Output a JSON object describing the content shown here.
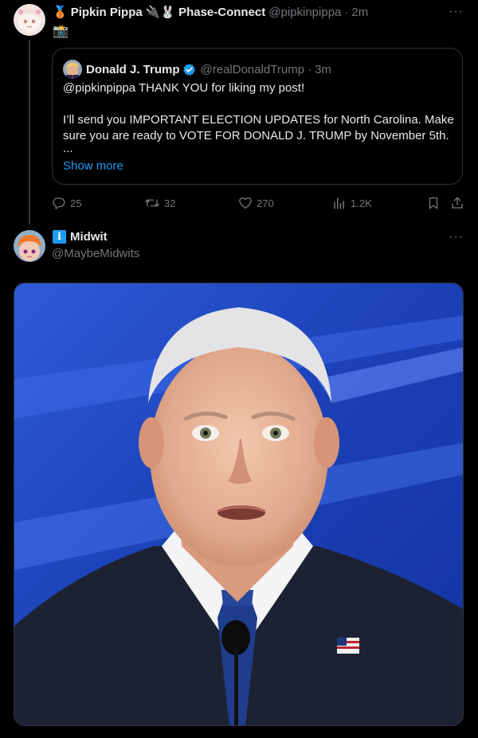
{
  "tweet1": {
    "display_name": "Pipkin Pippa",
    "badge_emoji": "🥉",
    "name_suffix_emojis": "🔌🐰",
    "affiliation": "Phase-Connect",
    "handle": "@pipkinpippa",
    "separator": "·",
    "time": "2m",
    "second_line_emoji": "📸",
    "more_label": "···",
    "quote": {
      "display_name": "Donald J. Trump",
      "handle": "@realDonaldTrump",
      "separator": "·",
      "time": "3m",
      "line1": "@pipkinpippa THANK YOU for liking my post!",
      "line2": "I’ll send you IMPORTANT ELECTION UPDATES for North Carolina. Make sure you are ready to VOTE FOR DONALD J. TRUMP by November 5th.",
      "ellipsis": "...",
      "show_more": "Show more"
    },
    "actions": {
      "replies": "25",
      "reposts": "32",
      "likes": "270",
      "views": "1.2K"
    }
  },
  "tweet2": {
    "display_name": "Midwit",
    "badge_label": "i",
    "handle": "@MaybeMidwits",
    "more_label": "···"
  },
  "colors": {
    "background": "#000000",
    "primary_text": "#e7e9ea",
    "secondary_text": "#71767b",
    "accent": "#1d9bf0",
    "border": "#2f3336"
  }
}
